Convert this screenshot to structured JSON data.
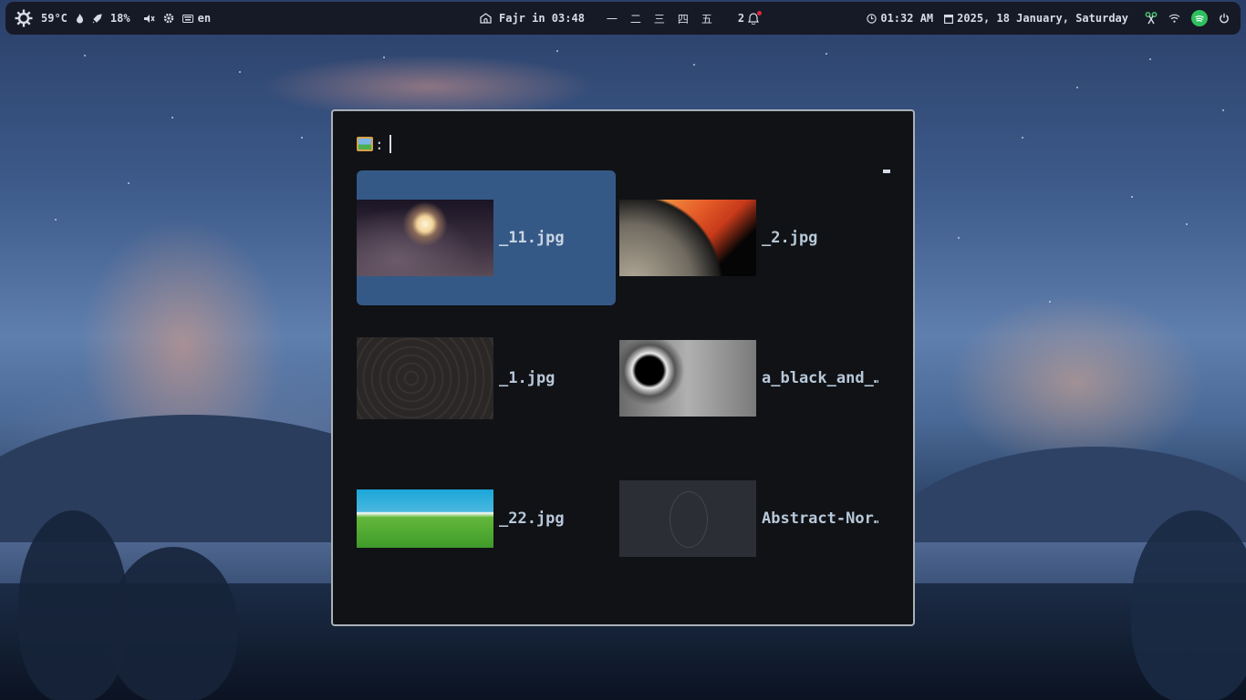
{
  "topbar": {
    "temperature": "59°C",
    "cpu_usage": "18%",
    "language": "en",
    "prayer_time": "Fajr in 03:48",
    "workspaces": [
      "一",
      "二",
      "三",
      "四",
      "五"
    ],
    "notification_count": "2",
    "clock": "01:32 AM",
    "date": "2025, 18 January, Saturday"
  },
  "launcher": {
    "prompt_label": ":",
    "query": "",
    "items": [
      {
        "label": "_11.jpg",
        "thumb": "moon-clouds",
        "selected": true
      },
      {
        "label": "_2.jpg",
        "thumb": "burning-planet",
        "selected": false
      },
      {
        "label": "_1.jpg",
        "thumb": "topographic",
        "selected": false
      },
      {
        "label": "a_black_and_…",
        "thumb": "black-white-eclipse",
        "selected": false
      },
      {
        "label": "_22.jpg",
        "thumb": "green-field",
        "selected": false
      },
      {
        "label": "Abstract-Nor…",
        "thumb": "abstract-dark",
        "selected": false
      }
    ]
  },
  "colors": {
    "bar_bg": "#161a26",
    "launcher_bg": "#101216",
    "selection": "#355986",
    "accent_green": "#2fbf5f"
  }
}
